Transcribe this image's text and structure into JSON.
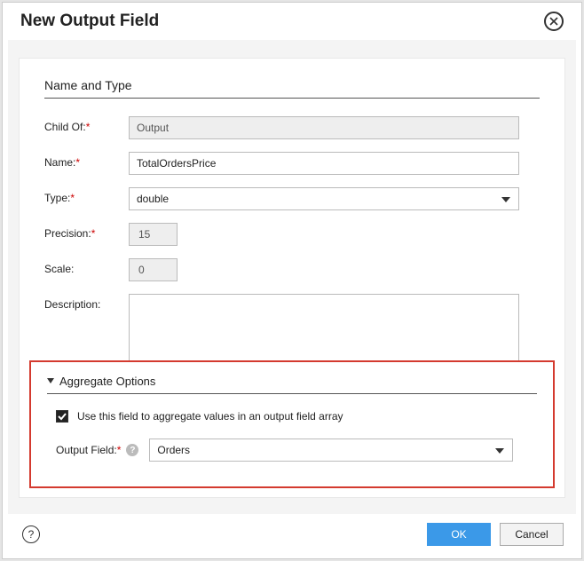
{
  "dialog": {
    "title": "New Output Field"
  },
  "section1": {
    "title": "Name and Type",
    "labels": {
      "childOf": "Child Of:",
      "name": "Name:",
      "type": "Type:",
      "precision": "Precision:",
      "scale": "Scale:",
      "description": "Description:"
    },
    "values": {
      "childOf": "Output",
      "name": "TotalOrdersPrice",
      "type": "double",
      "precision": "15",
      "scale": "0",
      "description": ""
    }
  },
  "section2": {
    "title": "Aggregate Options",
    "checkboxLabel": "Use this field to aggregate values in an output field array",
    "checkboxChecked": true,
    "outputFieldLabel": "Output Field:",
    "outputFieldValue": "Orders"
  },
  "footer": {
    "ok": "OK",
    "cancel": "Cancel"
  },
  "asterisk": "*"
}
